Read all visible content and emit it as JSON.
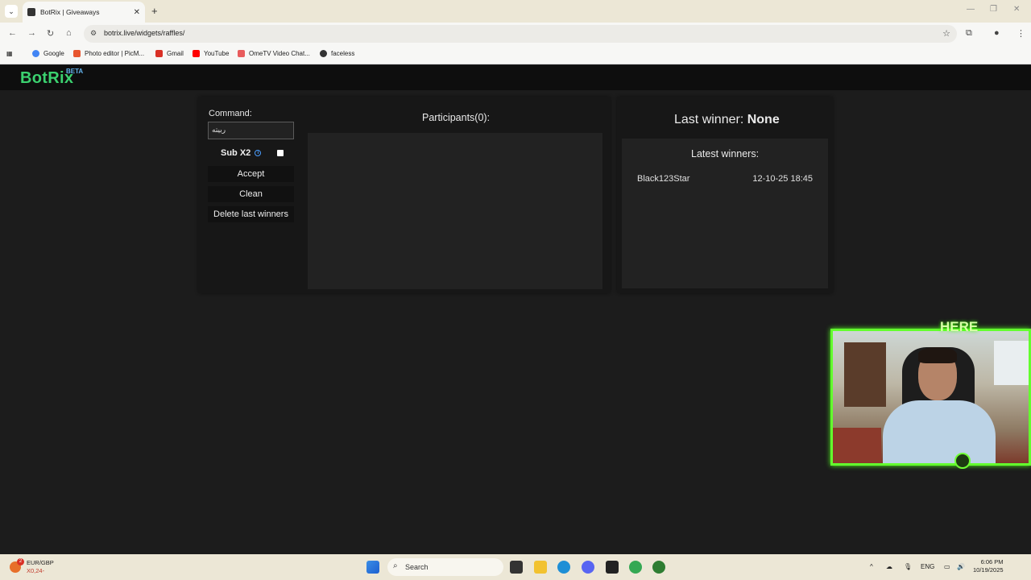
{
  "browser": {
    "tab_title": "BotRix | Giveaways",
    "url": "botrix.live/widgets/raffles/",
    "bookmarks": [
      "Google",
      "Photo editor | PicM...",
      "Gmail",
      "YouTube",
      "OmeTV Video Chat...",
      "faceless"
    ]
  },
  "site": {
    "logo": "BotRix",
    "badge": "BETA"
  },
  "left_panel": {
    "command_label": "Command:",
    "command_value": "ربیته",
    "sub_label": "Sub X2",
    "sub_checked": false,
    "buttons": [
      "Accept",
      "Clean",
      "Delete last winners"
    ]
  },
  "participants": {
    "title": "Participants(0):"
  },
  "right_panel": {
    "last_winner_label": "Last winner: ",
    "last_winner_value": "None",
    "latest_title": "Latest winners:",
    "winners": [
      {
        "name": "Black123Star",
        "date": "12-10-25 18:45"
      }
    ]
  },
  "overlay": {
    "text": "HERE"
  },
  "taskbar": {
    "ticker_name": "EUR/GBP",
    "ticker_value": "X0,24-",
    "ticker_badge": "2",
    "search_placeholder": "Search",
    "lang": "ENG",
    "time": "6:06 PM",
    "date": "10/19/2025"
  },
  "colors": {
    "accent": "#3bd16f",
    "badge": "#63b3ed",
    "overlay_green": "#63ff2d"
  }
}
